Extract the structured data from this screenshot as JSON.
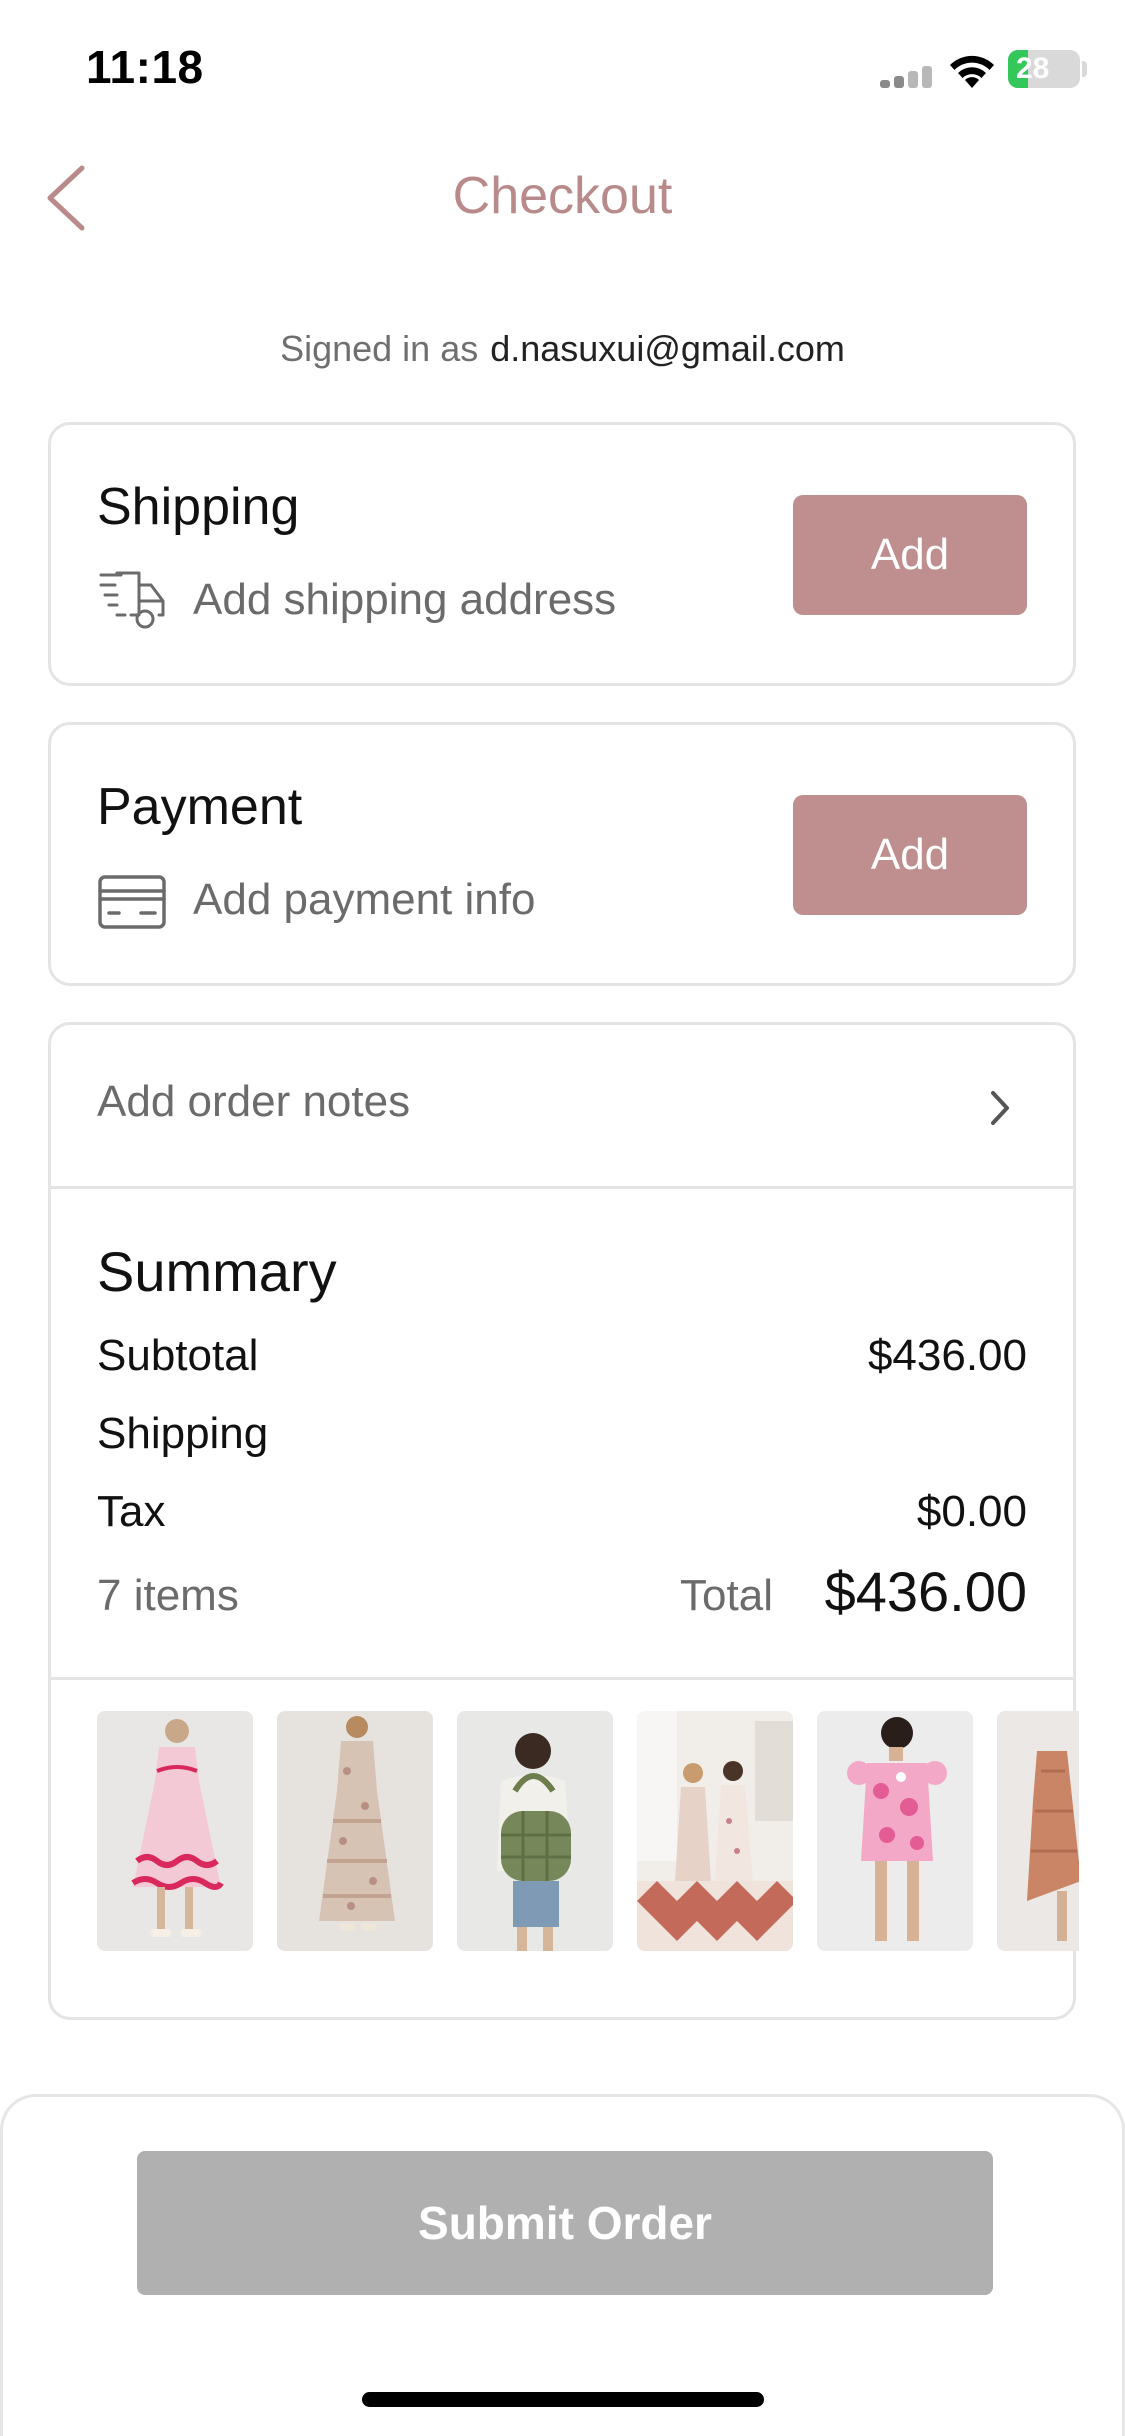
{
  "status_bar": {
    "time": "11:18",
    "battery": "28",
    "battery_level": 0.28
  },
  "header": {
    "title": "Checkout"
  },
  "account": {
    "signed_in_label": "Signed in as",
    "email": "d.nasuxui@gmail.com"
  },
  "shipping": {
    "title": "Shipping",
    "subtitle": "Add shipping address",
    "button": "Add",
    "icon": "delivery-truck-icon"
  },
  "payment": {
    "title": "Payment",
    "subtitle": "Add payment info",
    "button": "Add",
    "icon": "credit-card-icon"
  },
  "order_notes": {
    "label": "Add order notes"
  },
  "summary": {
    "title": "Summary",
    "subtotal_label": "Subtotal",
    "subtotal_value": "$436.00",
    "shipping_label": "Shipping",
    "shipping_value": "",
    "tax_label": "Tax",
    "tax_value": "$0.00",
    "items_count": "7 items",
    "total_label": "Total",
    "total_value": "$436.00"
  },
  "items": [
    {
      "name": "pink-dress-with-ric-rac-trim"
    },
    {
      "name": "floral-tiered-maxi-dress"
    },
    {
      "name": "green-quilted-tote-bag"
    },
    {
      "name": "floral-dresses-group-photo"
    },
    {
      "name": "pink-floral-mini-dress"
    },
    {
      "name": "rust-dress"
    }
  ],
  "footer": {
    "submit_button": "Submit Order"
  },
  "colors": {
    "accent": "#bf8e8e",
    "title": "#b98a8a",
    "disabled_button": "#b0b0b0",
    "border": "#e4e4e4"
  }
}
